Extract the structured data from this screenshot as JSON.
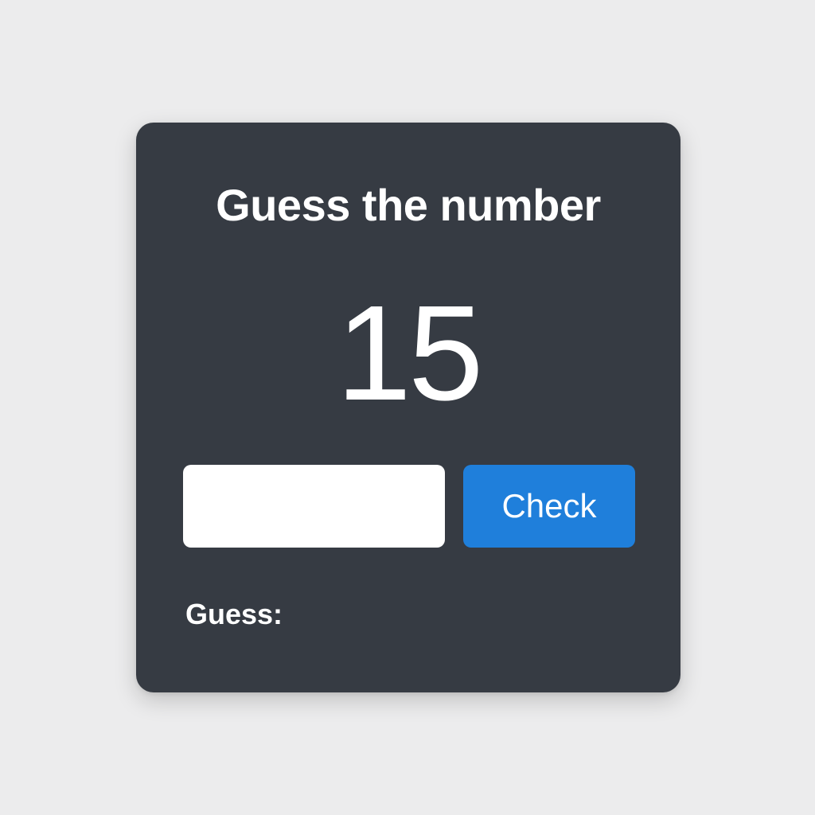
{
  "game": {
    "title": "Guess the number",
    "current_number": "15",
    "input": {
      "value": "",
      "placeholder": ""
    },
    "check_button_label": "Check",
    "guess_label": "Guess:",
    "guess_value": ""
  },
  "colors": {
    "background": "#ececed",
    "card": "#363b43",
    "button": "#1f7fdb",
    "text": "#ffffff"
  }
}
